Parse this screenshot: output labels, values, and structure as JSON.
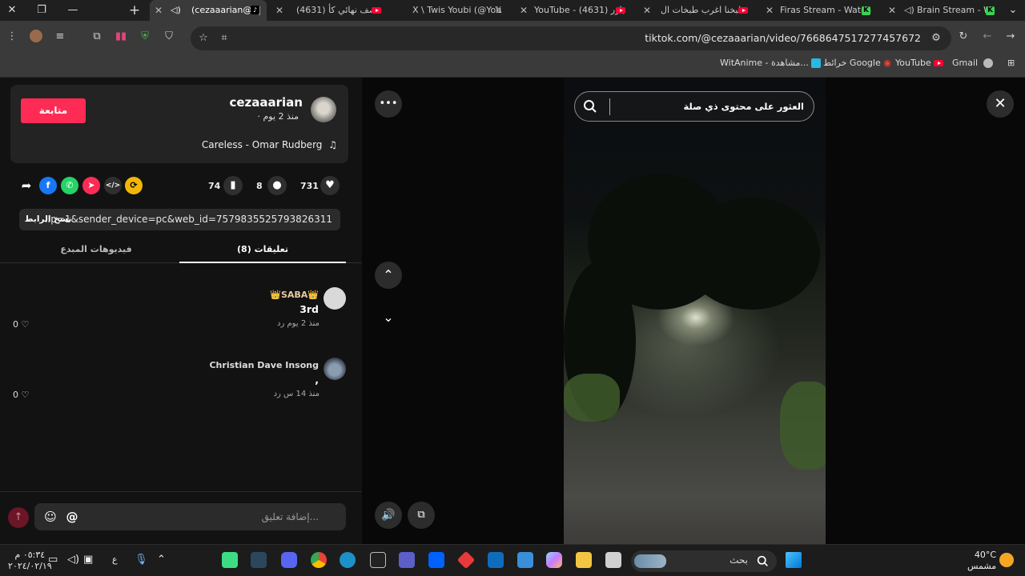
{
  "browser": {
    "tabs": [
      {
        "title": "(cezaaarian@) |",
        "active": true
      },
      {
        "title": "(4631) نصف نهائي كأ",
        "active": false
      },
      {
        "title": "X \\ Twis Youbi (@You",
        "active": false
      },
      {
        "title": "YouTube - باور (4631)",
        "active": false
      },
      {
        "title": "طبخنا اغرب طبخات ال",
        "active": false
      },
      {
        "title": "Firas Stream - Watch",
        "active": false
      },
      {
        "title": "Brain Stream - W",
        "active": false
      }
    ],
    "new_tab": "+",
    "url": "tiktok.com/@cezaaarian/video/7668647517277457672",
    "bookmarks": [
      {
        "label": "Gmail"
      },
      {
        "label": "YouTube"
      },
      {
        "label": "خرائط Google"
      },
      {
        "label": "WitAnime - مشاهدة..."
      }
    ]
  },
  "author": {
    "follow_label": "متابعة",
    "name": "cezaaarian",
    "time": "· منذ 2 يوم",
    "music": "Careless - Omar Rudberg",
    "music_icon": "♫"
  },
  "stats": {
    "likes": "731",
    "comments": "8",
    "saves": "74"
  },
  "share": {
    "link": "...p=1&sender_device=pc&web_id=7579835525793826311",
    "copy_label": "نسخ الرابط"
  },
  "comment_tabs": {
    "comments": "(8) تعليقات",
    "creator_videos": "فيديوهات المبدع"
  },
  "comments": [
    {
      "user": "👑SABA👑",
      "text": "3rd",
      "meta": "منذ 2 يوم    رد",
      "likes": "0"
    },
    {
      "user": "Christian Dave Insong",
      "text": ",",
      "meta": "منذ 14 س    رد",
      "likes": "0"
    }
  ],
  "comment_input": {
    "placeholder": "إضافة تعليق..."
  },
  "video": {
    "search_text": "العثور على محتوى ذي صلة"
  },
  "taskbar": {
    "search_placeholder": "بحث",
    "weather_temp": "40°C",
    "weather_desc": "مشمس",
    "time": "٠٥:٣٤ م",
    "date": "٢٠٢٤/٠٢/١٩",
    "lang": "ع"
  },
  "colors": {
    "accent": "#fe2c55",
    "tiktok_bg": "#121212",
    "card": "#232323"
  }
}
